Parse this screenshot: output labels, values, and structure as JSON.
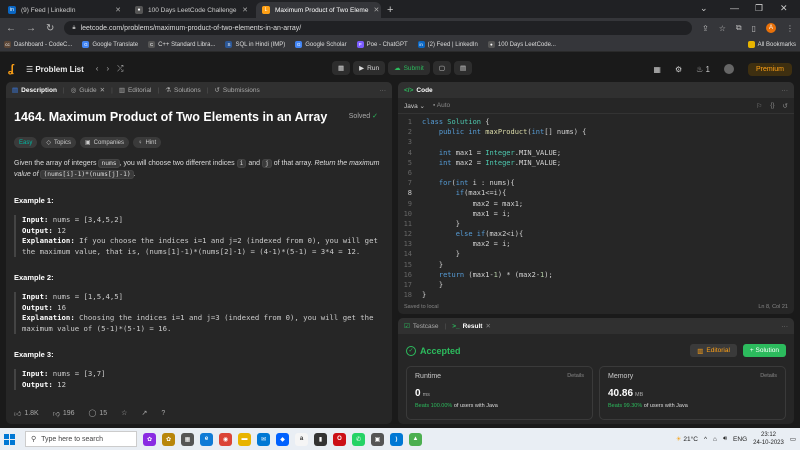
{
  "browser": {
    "tabs": [
      {
        "title": "(9) Feed | LinkedIn",
        "fav": "in",
        "color": "#0a66c2"
      },
      {
        "title": "100 Days LeetCode Challenge",
        "fav": "●",
        "color": "#555"
      },
      {
        "title": "Maximum Product of Two Eleme",
        "fav": "L",
        "color": "#ffa116"
      }
    ],
    "url": "leetcode.com/problems/maximum-product-of-two-elements-in-an-array/",
    "avatar": "A",
    "bookmarks": [
      {
        "label": "Dashboard - CodeC...",
        "fav": "cc",
        "color": "#5b4636"
      },
      {
        "label": "Google Translate",
        "fav": "G",
        "color": "#4285f4"
      },
      {
        "label": "C++ Standard Libra...",
        "fav": "C",
        "color": "#555"
      },
      {
        "label": "SQL in Hindi (IMP)",
        "fav": "S",
        "color": "#2b5797"
      },
      {
        "label": "Google Scholar",
        "fav": "G",
        "color": "#4285f4"
      },
      {
        "label": "Poe - ChatGPT",
        "fav": "P",
        "color": "#7b5cff"
      },
      {
        "label": "(2) Feed | LinkedIn",
        "fav": "in",
        "color": "#0a66c2"
      },
      {
        "label": "100 Days LeetCode...",
        "fav": "●",
        "color": "#555"
      }
    ],
    "all_bookmarks": "All Bookmarks"
  },
  "lcnav": {
    "problem_list": "Problem List",
    "run": "Run",
    "submit": "Submit",
    "streak": "1",
    "premium": "Premium"
  },
  "desc": {
    "tabs": {
      "description": "Description",
      "guide": "Guide",
      "editorial": "Editorial",
      "solutions": "Solutions",
      "submissions": "Submissions"
    },
    "title": "1464. Maximum Product of Two Elements in an Array",
    "solved": "Solved",
    "chips": {
      "difficulty": "Easy",
      "topics": "Topics",
      "companies": "Companies",
      "hint": "Hint"
    },
    "stmt_1": "Given the array of integers ",
    "stmt_nums": "nums",
    "stmt_2": ", you will choose two different indices ",
    "stmt_i": "i",
    "stmt_and": " and ",
    "stmt_j": "j",
    "stmt_3": " of that array. ",
    "stmt_ret": "Return the maximum value of ",
    "stmt_expr": "(nums[i]-1)*(nums[j]-1)",
    "stmt_end": ".",
    "ex1_h": "Example 1:",
    "ex1_in": "nums = [3,4,5,2]",
    "ex1_out": "12",
    "ex1_exp": "If you choose the indices i=1 and j=2 (indexed from 0), you will get the maximum value, that is, (nums[1]-1)*(nums[2]-1) = (4-1)*(5-1) = 3*4 = 12.",
    "ex2_h": "Example 2:",
    "ex2_in": "nums = [1,5,4,5]",
    "ex2_out": "16",
    "ex2_exp": "Choosing the indices i=1 and j=3 (indexed from 0), you will get the maximum value of (5-1)*(5-1) = 16.",
    "ex3_h": "Example 3:",
    "ex3_in": "nums = [3,7]",
    "ex3_out": "12",
    "lbl_input": "Input:",
    "lbl_output": "Output:",
    "lbl_expl": "Explanation:",
    "likes": "1.8K",
    "dislikes": "196",
    "comments": "15"
  },
  "code": {
    "title": "Code",
    "lang": "Java",
    "auto": "Auto",
    "saved": "Saved to local",
    "cursor": "Ln 8, Col 21"
  },
  "result": {
    "tab_testcase": "Testcase",
    "tab_result": "Result",
    "status": "Accepted",
    "editorial_btn": "Editorial",
    "solution_btn": "+ Solution",
    "runtime_label": "Runtime",
    "runtime_value": "0",
    "runtime_unit": "ms",
    "runtime_beats_pct": "Beats 100.00%",
    "runtime_beats_rest": " of users with Java",
    "memory_label": "Memory",
    "memory_value": "40.86",
    "memory_unit": "MB",
    "memory_beats_pct": "Beats 99.30%",
    "memory_beats_rest": " of users with Java",
    "details": "Details"
  },
  "taskbar": {
    "search_placeholder": "Type here to search",
    "weather": "21°C",
    "lang": "ENG",
    "time": "23:12",
    "date": "24-10-2023"
  }
}
